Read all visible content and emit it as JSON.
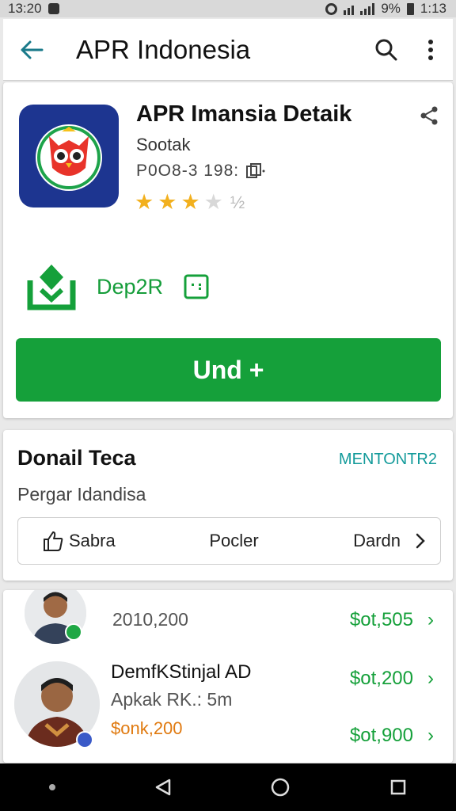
{
  "status_bar": {
    "time_left": "13:20",
    "battery_text": "9%",
    "time_right": "1:13"
  },
  "app_bar": {
    "title": "APR Indonesia",
    "back_icon": "arrow-left-icon",
    "search_icon": "search-icon",
    "menu_icon": "more-vertical-icon"
  },
  "app": {
    "name": "APR Imansia Detaik",
    "developer": "Sootak",
    "meta": "P0O8-3 198:",
    "rating_stars_filled": 3,
    "rating_stars_total": 5,
    "rating_value_text": "½",
    "download_label": "Dep2R",
    "install_label": "Und +",
    "colors": {
      "accent_green": "#15a03a",
      "teal": "#1a7a8a",
      "icon_bg": "#1d3590",
      "star": "#f2b01e"
    }
  },
  "details": {
    "title": "Donail Teca",
    "link": "MENTONTR2",
    "subtitle": "Pergar Idandisa",
    "tabs": [
      {
        "label": "Sabra",
        "icon": "thumbs-up-icon"
      },
      {
        "label": "Pocler"
      },
      {
        "label": "Dardn",
        "icon": "chevron-right-icon"
      }
    ]
  },
  "list": {
    "rows": [
      {
        "text": "2010,200",
        "price": "$ot,505"
      },
      {
        "name": "DemfKStinjal AD",
        "sub": "Apkak RK.: 5m",
        "amount": "$onk,200",
        "price": "$ot,200",
        "price2": "$ot,900"
      }
    ]
  }
}
